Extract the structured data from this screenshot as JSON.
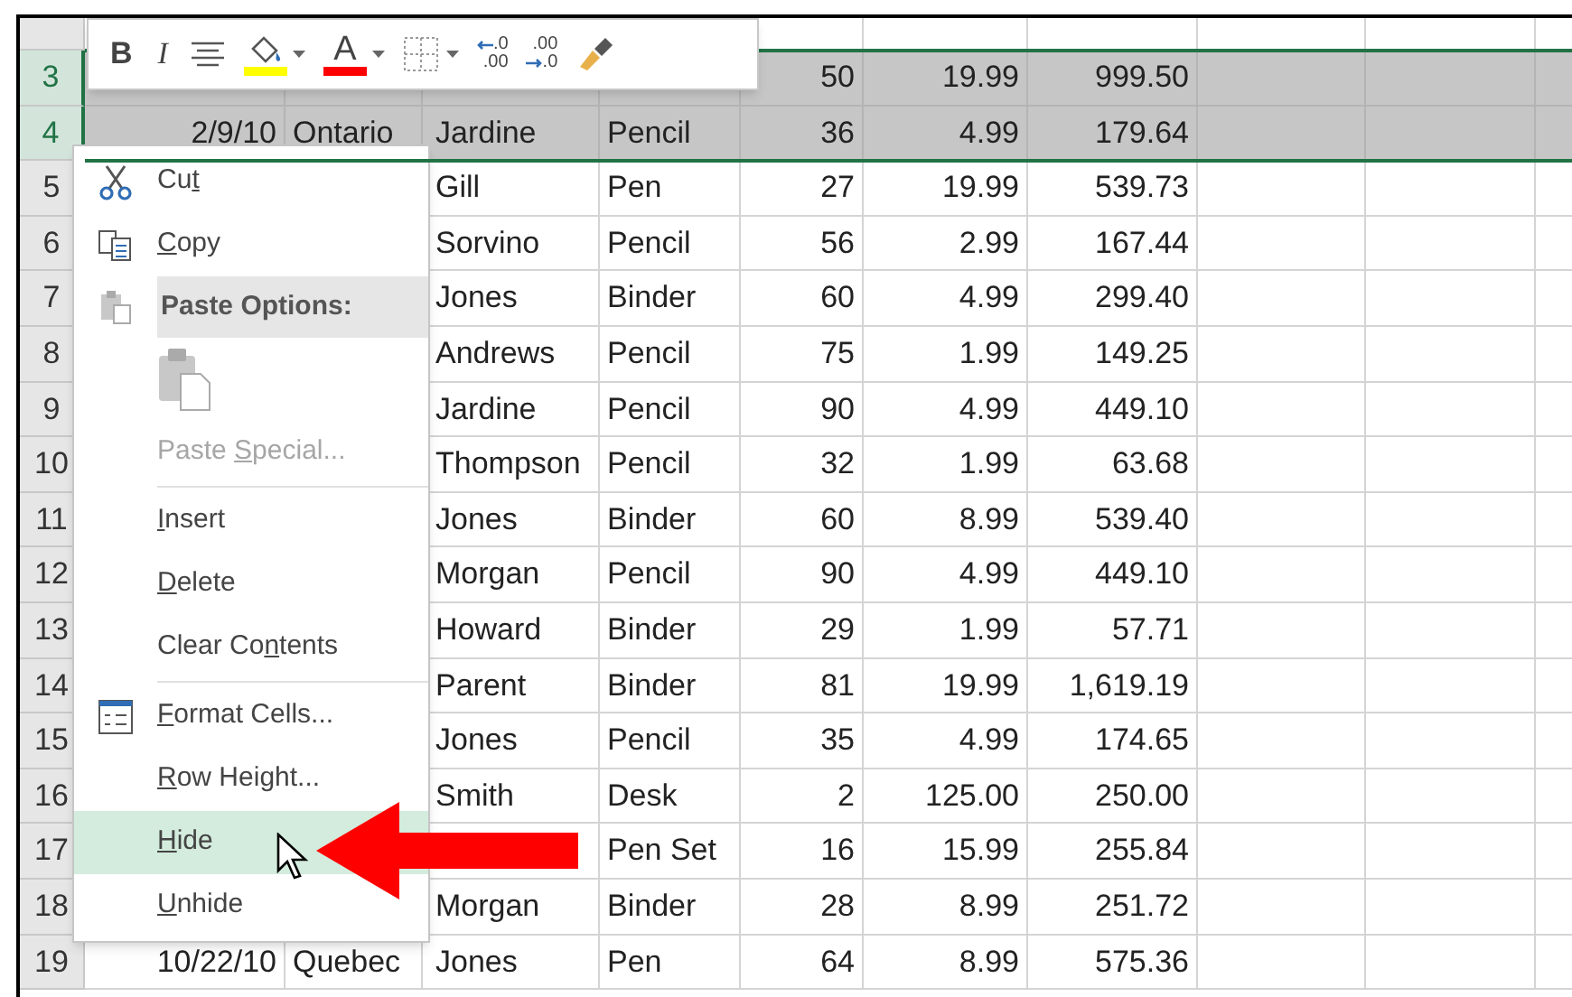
{
  "mini_toolbar": {
    "buttons": [
      {
        "kind": "bold",
        "label": "B"
      },
      {
        "kind": "italic",
        "label": "I"
      },
      {
        "kind": "align"
      },
      {
        "kind": "fill",
        "color": "#ffff00"
      },
      {
        "kind": "font_color",
        "label": "A",
        "color": "#ff0000"
      },
      {
        "kind": "borders"
      },
      {
        "kind": "increase_decimal",
        "top": ".0",
        "bottom": ".00"
      },
      {
        "kind": "decrease_decimal",
        "top": ".00",
        "bottom": ".0"
      },
      {
        "kind": "painter"
      }
    ]
  },
  "sheet": {
    "rows": [
      {
        "header": "3",
        "selected": true,
        "cells": [
          null,
          null,
          null,
          null,
          "50",
          "19.99",
          "999.50"
        ]
      },
      {
        "header": "4",
        "selected": true,
        "cells": [
          "2/9/10",
          "Ontario",
          "Jardine",
          "Pencil",
          "36",
          "4.99",
          "179.64"
        ]
      },
      {
        "header": "5",
        "selected": false,
        "cells": [
          null,
          null,
          "Gill",
          "Pen",
          "27",
          "19.99",
          "539.73"
        ]
      },
      {
        "header": "6",
        "selected": false,
        "cells": [
          null,
          null,
          "Sorvino",
          "Pencil",
          "56",
          "2.99",
          "167.44"
        ]
      },
      {
        "header": "7",
        "selected": false,
        "cells": [
          null,
          null,
          "Jones",
          "Binder",
          "60",
          "4.99",
          "299.40"
        ]
      },
      {
        "header": "8",
        "selected": false,
        "cells": [
          null,
          null,
          "Andrews",
          "Pencil",
          "75",
          "1.99",
          "149.25"
        ]
      },
      {
        "header": "9",
        "selected": false,
        "cells": [
          null,
          null,
          "Jardine",
          "Pencil",
          "90",
          "4.99",
          "449.10"
        ]
      },
      {
        "header": "10",
        "selected": false,
        "cells": [
          null,
          null,
          "Thompson",
          "Pencil",
          "32",
          "1.99",
          "63.68"
        ]
      },
      {
        "header": "11",
        "selected": false,
        "cells": [
          null,
          null,
          "Jones",
          "Binder",
          "60",
          "8.99",
          "539.40"
        ]
      },
      {
        "header": "12",
        "selected": false,
        "cells": [
          null,
          null,
          "Morgan",
          "Pencil",
          "90",
          "4.99",
          "449.10"
        ]
      },
      {
        "header": "13",
        "selected": false,
        "cells": [
          null,
          null,
          "Howard",
          "Binder",
          "29",
          "1.99",
          "57.71"
        ]
      },
      {
        "header": "14",
        "selected": false,
        "cells": [
          null,
          null,
          "Parent",
          "Binder",
          "81",
          "19.99",
          "1,619.19"
        ]
      },
      {
        "header": "15",
        "selected": false,
        "cells": [
          null,
          null,
          "Jones",
          "Pencil",
          "35",
          "4.99",
          "174.65"
        ]
      },
      {
        "header": "16",
        "selected": false,
        "cells": [
          null,
          null,
          "Smith",
          "Desk",
          "2",
          "125.00",
          "250.00"
        ]
      },
      {
        "header": "17",
        "selected": false,
        "cells": [
          null,
          null,
          null,
          "Pen Set",
          "16",
          "15.99",
          "255.84"
        ]
      },
      {
        "header": "18",
        "selected": false,
        "cells": [
          null,
          null,
          "Morgan",
          "Binder",
          "28",
          "8.99",
          "251.72"
        ]
      },
      {
        "header": "19",
        "selected": false,
        "cells": [
          "10/22/10",
          "Quebec",
          "Jones",
          "Pen",
          "64",
          "8.99",
          "575.36"
        ]
      }
    ]
  },
  "context_menu": {
    "items": [
      {
        "kind": "command",
        "label": [
          {
            "text": "Cu",
            "underlined": false
          },
          {
            "text": "t",
            "underlined": true
          }
        ],
        "disabled": false,
        "selected": false
      },
      {
        "kind": "command",
        "label": [
          {
            "text": "C",
            "underlined": true
          },
          {
            "text": "opy",
            "underlined": false
          }
        ],
        "disabled": false,
        "selected": false
      },
      {
        "kind": "heading",
        "label": "Paste Options:"
      },
      {
        "kind": "paste_icon"
      },
      {
        "kind": "command",
        "label": [
          {
            "text": "Paste ",
            "underlined": false
          },
          {
            "text": "S",
            "underlined": true
          },
          {
            "text": "pecial...",
            "underlined": false
          }
        ],
        "disabled": true,
        "selected": false
      },
      {
        "kind": "separator"
      },
      {
        "kind": "command",
        "label": [
          {
            "text": "I",
            "underlined": true
          },
          {
            "text": "nsert",
            "underlined": false
          }
        ],
        "disabled": false,
        "selected": false
      },
      {
        "kind": "command",
        "label": [
          {
            "text": "D",
            "underlined": true
          },
          {
            "text": "elete",
            "underlined": false
          }
        ],
        "disabled": false,
        "selected": false
      },
      {
        "kind": "command",
        "label": [
          {
            "text": "Clear Co",
            "underlined": false
          },
          {
            "text": "n",
            "underlined": true
          },
          {
            "text": "tents",
            "underlined": false
          }
        ],
        "disabled": false,
        "selected": false
      },
      {
        "kind": "separator"
      },
      {
        "kind": "command",
        "label": [
          {
            "text": "F",
            "underlined": true
          },
          {
            "text": "ormat Cells...",
            "underlined": false
          }
        ],
        "disabled": false,
        "selected": false
      },
      {
        "kind": "command",
        "label": [
          {
            "text": "R",
            "underlined": true
          },
          {
            "text": "ow Height...",
            "underlined": false
          }
        ],
        "disabled": false,
        "selected": false
      },
      {
        "kind": "command",
        "label": [
          {
            "text": "H",
            "underlined": true
          },
          {
            "text": "ide",
            "underlined": false
          }
        ],
        "disabled": false,
        "selected": true
      },
      {
        "kind": "command",
        "label": [
          {
            "text": "U",
            "underlined": true
          },
          {
            "text": "nhide",
            "underlined": false
          }
        ],
        "disabled": false,
        "selected": false
      }
    ]
  }
}
